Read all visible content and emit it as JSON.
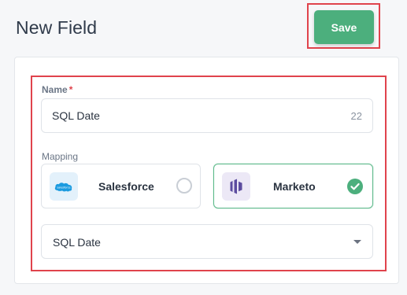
{
  "header": {
    "title": "New Field",
    "save_label": "Save"
  },
  "form": {
    "name_label": "Name",
    "name_required_marker": "*",
    "name_value": "SQL Date",
    "name_char_count": "22",
    "mapping_label": "Mapping",
    "mapping_options": [
      {
        "label": "Salesforce",
        "icon": "salesforce-logo-icon",
        "selected": false
      },
      {
        "label": "Marketo",
        "icon": "marketo-logo-icon",
        "selected": true
      }
    ],
    "mapping_field_value": "SQL Date"
  },
  "colors": {
    "accent": "#4caf7d",
    "highlight": "#e0434c",
    "salesforce": "#1b9be0",
    "marketo": "#5c4c9f"
  }
}
